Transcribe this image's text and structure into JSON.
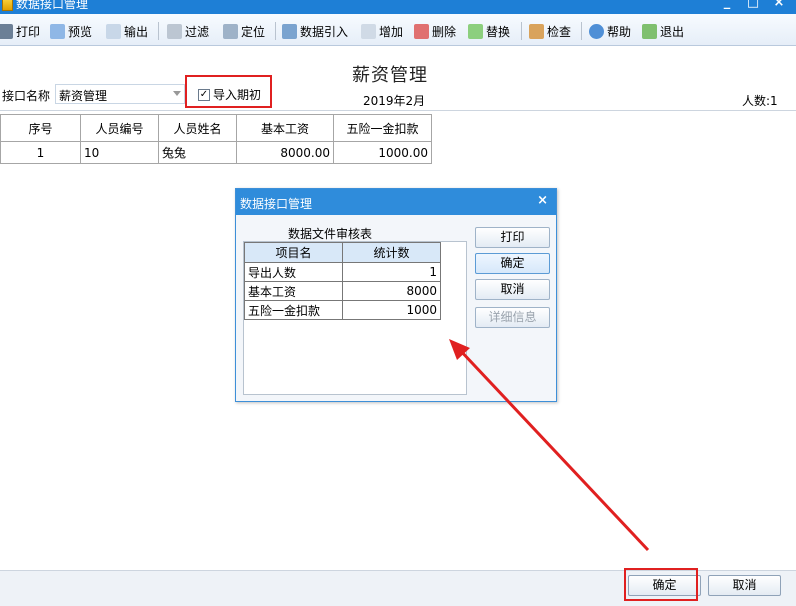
{
  "window": {
    "title": "数据接口管理",
    "controls": [
      "_",
      "□",
      "×"
    ]
  },
  "toolbar": {
    "items": [
      {
        "label": "打印",
        "icon": "printer-icon"
      },
      {
        "label": "预览",
        "icon": "preview-icon"
      },
      {
        "label": "输出",
        "icon": "export-icon"
      },
      {
        "label": "过滤",
        "icon": "filter-icon"
      },
      {
        "label": "定位",
        "icon": "locate-icon"
      },
      {
        "label": "数据引入",
        "icon": "data-import-icon"
      },
      {
        "label": "增加",
        "icon": "add-icon"
      },
      {
        "label": "删除",
        "icon": "delete-icon"
      },
      {
        "label": "替换",
        "icon": "replace-icon"
      },
      {
        "label": "检查",
        "icon": "check-icon"
      },
      {
        "label": "帮助",
        "icon": "help-icon"
      },
      {
        "label": "退出",
        "icon": "exit-icon"
      }
    ]
  },
  "main": {
    "title": "薪资管理",
    "interface_label": "接口名称",
    "interface_value": "薪资管理",
    "import_checkbox_label": "导入期初",
    "import_checked": true,
    "period": "2019年2月",
    "headcount": "人数:1",
    "table": {
      "headers": [
        "序号",
        "人员编号",
        "人员姓名",
        "基本工资",
        "五险一金扣款"
      ],
      "rows": [
        [
          "1",
          "10",
          "兔兔",
          "8000.00",
          "1000.00"
        ]
      ]
    }
  },
  "dialog": {
    "title": "数据接口管理",
    "close": "×",
    "caption": "数据文件审核表",
    "table": {
      "headers": [
        "项目名",
        "统计数"
      ],
      "rows": [
        [
          "导出人数",
          "1"
        ],
        [
          "基本工资",
          "8000"
        ],
        [
          "五险一金扣款",
          "1000"
        ]
      ]
    },
    "buttons": {
      "print": "打印",
      "ok": "确定",
      "cancel": "取消",
      "details": "详细信息"
    }
  },
  "footer": {
    "ok": "确定",
    "cancel": "取消"
  },
  "colors": {
    "titlebar": "#1e7fd6",
    "highlight": "#e02020",
    "dialog_header": "#2f8cdb"
  }
}
